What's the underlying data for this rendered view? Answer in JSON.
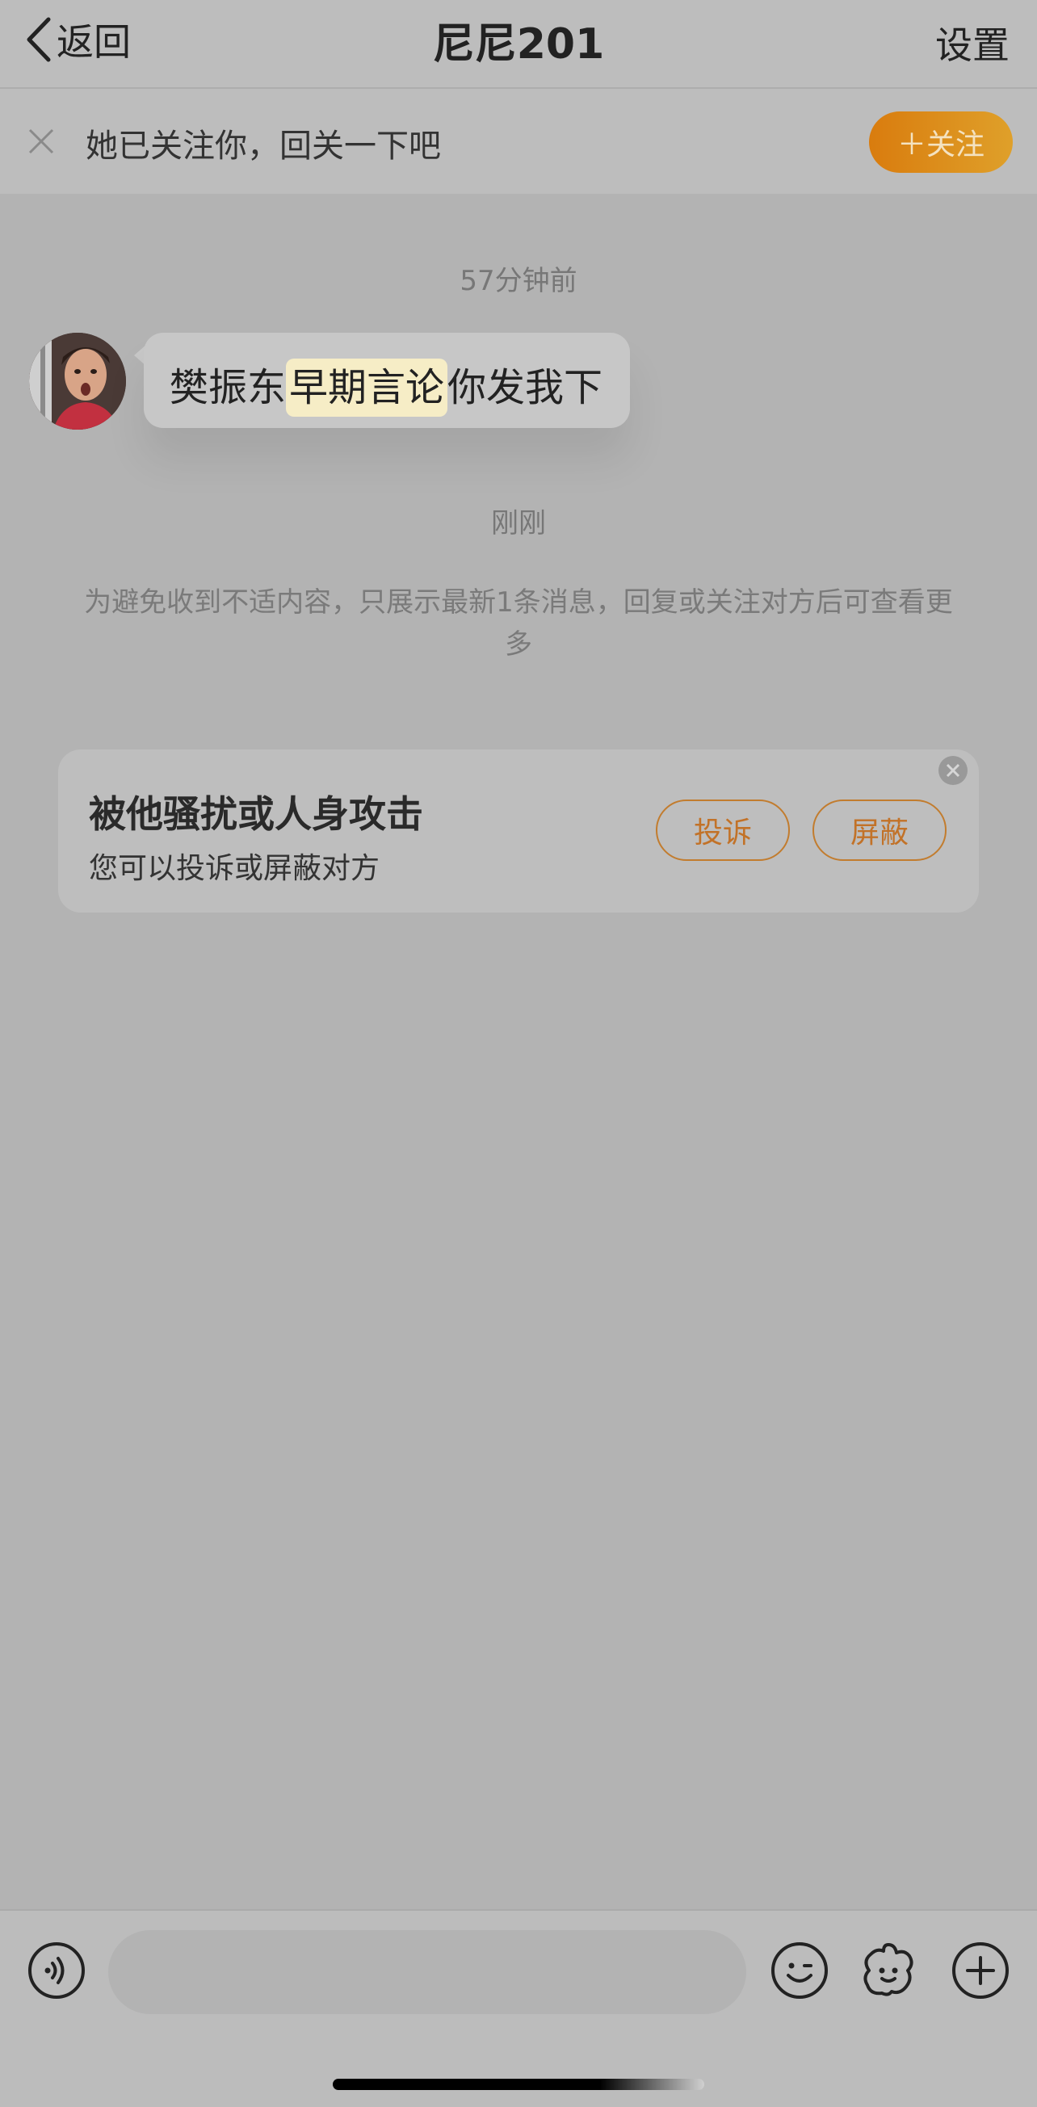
{
  "nav": {
    "back_label": "返回",
    "title": "尼尼201",
    "settings_label": "设置"
  },
  "follow_banner": {
    "text": "她已关注你，回关一下吧",
    "button_label": "＋关注"
  },
  "messages": [
    {
      "timestamp": "57分钟前",
      "text_before": "樊振东",
      "text_highlight": "早期言论",
      "text_after": "你发我下"
    }
  ],
  "second_timestamp": "刚刚",
  "notice": "为避免收到不适内容，只展示最新1条消息，回复或关注对方后可查看更多",
  "report_card": {
    "title": "被他骚扰或人身攻击",
    "subtitle": "您可以投诉或屏蔽对方",
    "report_label": "投诉",
    "block_label": "屏蔽"
  },
  "input_bar": {
    "placeholder": "",
    "value": ""
  },
  "colors": {
    "accent_orange": "#d98a1a",
    "background": "#b3b3b3",
    "highlight": "#f6edc6"
  },
  "icons": [
    "chevron-left-icon",
    "close-icon",
    "voice-icon",
    "emoji-icon",
    "sticker-icon",
    "plus-icon"
  ]
}
